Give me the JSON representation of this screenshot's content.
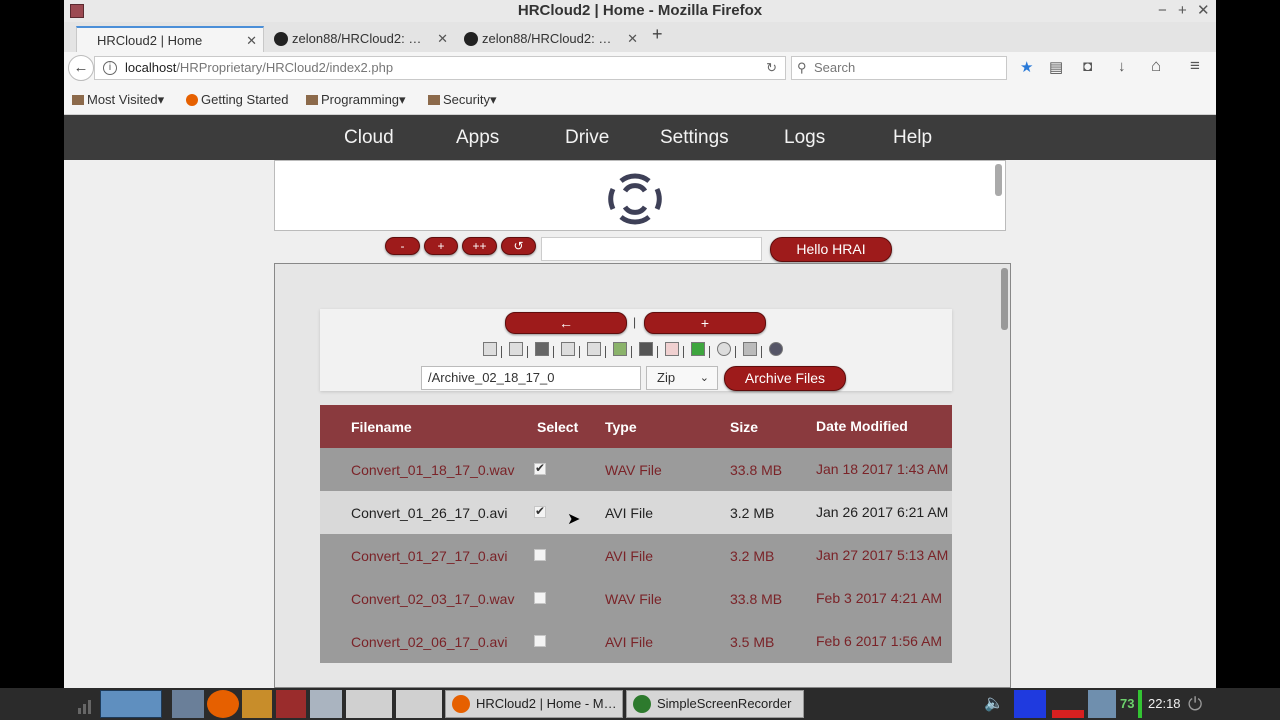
{
  "window": {
    "title": "HRCloud2 | Home - Mozilla Firefox",
    "controls": [
      "−",
      "+",
      "✕"
    ]
  },
  "tabs": [
    {
      "label": "HRCloud2 | Home",
      "close": "✕"
    },
    {
      "label": "zelon88/HRCloud2: …",
      "close": "✕"
    },
    {
      "label": "zelon88/HRCloud2: …",
      "close": "✕"
    }
  ],
  "newtab": "+",
  "url": {
    "host": "localhost",
    "path": "/HRProprietary/HRCloud2/index2.php",
    "reload": "↻"
  },
  "search": {
    "placeholder": "Search"
  },
  "nav_icons": {
    "back": "←",
    "star": "★",
    "reader": "▤",
    "pocket": "◘",
    "download": "↓",
    "home": "⌂",
    "menu": "≡"
  },
  "bookmarks": [
    {
      "label": "Most Visited▾"
    },
    {
      "label": "Getting Started"
    },
    {
      "label": "Programming▾"
    },
    {
      "label": "Security▾"
    }
  ],
  "appnav": [
    "Cloud",
    "Apps",
    "Drive",
    "Settings",
    "Logs",
    "Help"
  ],
  "controls": {
    "minus": "-",
    "plus": "+",
    "plusplus": "++",
    "refresh": "↺",
    "hello": "Hello HRAI"
  },
  "toolbox": {
    "back": "←",
    "add": "+",
    "path": "/Archive_02_18_17_0",
    "format": "Zip",
    "archive": "Archive Files"
  },
  "table": {
    "headers": [
      "Filename",
      "Select",
      "Type",
      "Size",
      "Date Modified"
    ],
    "rows": [
      {
        "name": "Convert_01_18_17_0.wav",
        "type": "WAV File",
        "size": "33.8 MB",
        "date": "Jan 18 2017 1:43 AM",
        "checked": true
      },
      {
        "name": "Convert_01_26_17_0.avi",
        "type": "AVI File",
        "size": "3.2 MB",
        "date": "Jan 26 2017 6:21 AM",
        "checked": true
      },
      {
        "name": "Convert_01_27_17_0.avi",
        "type": "AVI File",
        "size": "3.2 MB",
        "date": "Jan 27 2017 5:13 AM",
        "checked": false
      },
      {
        "name": "Convert_02_03_17_0.wav",
        "type": "WAV File",
        "size": "33.8 MB",
        "date": "Feb 3 2017 4:21 AM",
        "checked": false
      },
      {
        "name": "Convert_02_06_17_0.avi",
        "type": "AVI File",
        "size": "3.5 MB",
        "date": "Feb 6 2017 1:56 AM",
        "checked": false
      }
    ]
  },
  "taskbar": {
    "tasks": [
      "HRCloud2 | Home - M…",
      "SimpleScreenRecorder"
    ],
    "tray_number": "73",
    "clock": "22:18"
  },
  "colors": {
    "accent_red": "#9e1b1b",
    "header_red": "#8a3a3e",
    "nav_dark": "#3c3c3c"
  }
}
